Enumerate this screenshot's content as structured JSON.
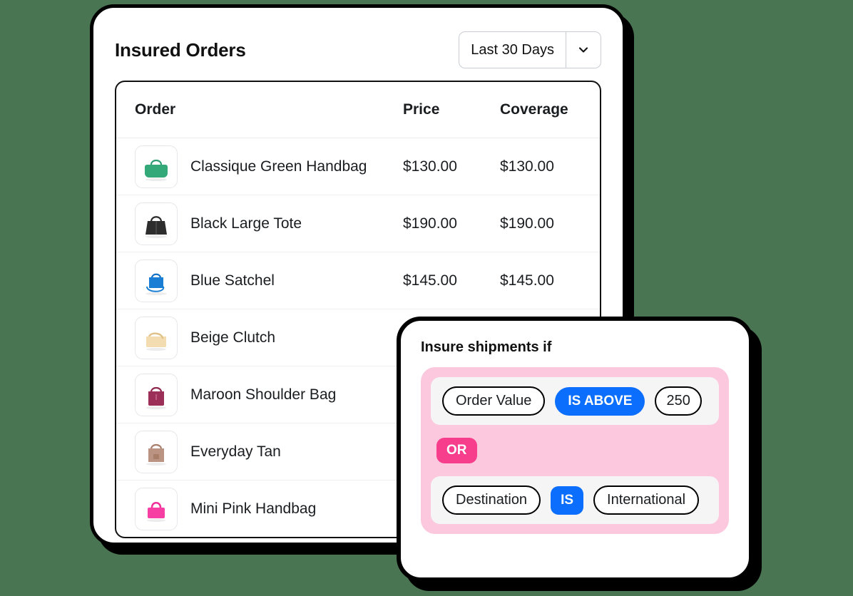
{
  "orders_card": {
    "title": "Insured Orders",
    "range_select": {
      "value": "Last 30 Days",
      "chevron_icon": "chevron-down-icon"
    },
    "table": {
      "columns": [
        "Order",
        "Price",
        "Coverage"
      ],
      "rows": [
        {
          "name": "Classique Green Handbag",
          "price": "$130.00",
          "coverage": "$130.00",
          "thumb_icon": "handbag-green-icon"
        },
        {
          "name": "Black Large Tote",
          "price": "$190.00",
          "coverage": "$190.00",
          "thumb_icon": "tote-black-icon"
        },
        {
          "name": "Blue Satchel",
          "price": "$145.00",
          "coverage": "$145.00",
          "thumb_icon": "satchel-blue-icon"
        },
        {
          "name": "Beige Clutch",
          "price": "",
          "coverage": "",
          "thumb_icon": "clutch-beige-icon"
        },
        {
          "name": "Maroon Shoulder Bag",
          "price": "",
          "coverage": "",
          "thumb_icon": "shoulderbag-maroon-icon"
        },
        {
          "name": "Everyday Tan",
          "price": "",
          "coverage": "",
          "thumb_icon": "tote-tan-icon"
        },
        {
          "name": "Mini Pink Handbag",
          "price": "",
          "coverage": "",
          "thumb_icon": "handbag-pink-icon"
        }
      ]
    }
  },
  "rule_card": {
    "title": "Insure shipments if",
    "conditions": [
      {
        "field": "Order Value",
        "operator": "IS ABOVE",
        "value": "250"
      },
      {
        "field": "Destination",
        "operator": "IS",
        "value": "International"
      }
    ],
    "connector": "OR"
  },
  "colors": {
    "background": "#4a7552",
    "accent_blue": "#0b6efd",
    "accent_pink": "#f73e8c",
    "group_pink": "#fbc8dd",
    "border_black": "#000000"
  }
}
